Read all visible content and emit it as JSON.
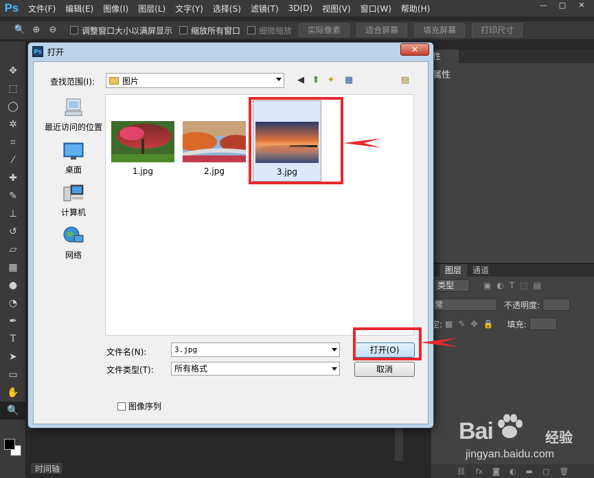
{
  "app": {
    "logo": "Ps",
    "menu": [
      "文件(F)",
      "编辑(E)",
      "图像(I)",
      "图层(L)",
      "文字(Y)",
      "选择(S)",
      "滤镜(T)",
      "3D(D)",
      "视图(V)",
      "窗口(W)",
      "帮助(H)"
    ],
    "window_controls": [
      "—",
      "□",
      "✕"
    ]
  },
  "options_bar": {
    "tool_icon": "zoom-icon",
    "check_resize": "调整窗口大小以满屏显示",
    "check_zoom_all": "缩放所有窗口",
    "check_scrubby": "细微缩放",
    "btn_actual": "实际像素",
    "btn_fit": "适合屏幕",
    "btn_fill": "填充屏幕",
    "btn_print": "打印尺寸"
  },
  "tools": [
    "move-icon",
    "marquee-icon",
    "lasso-icon",
    "magic-wand-icon",
    "crop-icon",
    "eyedropper-icon",
    "healing-icon",
    "brush-icon",
    "stamp-icon",
    "history-brush-icon",
    "eraser-icon",
    "gradient-icon",
    "blur-icon",
    "dodge-icon",
    "pen-icon",
    "type-icon",
    "path-select-icon",
    "shape-icon",
    "hand-icon",
    "zoom-icon"
  ],
  "colors": {
    "foreground": "#000000",
    "background": "#ffffff",
    "annotation": "#e8292e"
  },
  "right_panel": {
    "properties_tab": "性",
    "properties_title": "属性",
    "layers_tab": "图层",
    "channels_tab": "通道",
    "filter_kind": "类型",
    "blend_mode": "常",
    "opacity_label": "不透明度:",
    "lock_label": "定:",
    "fill_label": "填充:"
  },
  "timeline_tab": "时间轴",
  "dialog": {
    "title": "打开",
    "close": "✕",
    "look_in_label": "查找范围(I):",
    "look_in_value": "图片",
    "places": [
      {
        "label": "最近访问的位置",
        "icon": "recent-places-icon"
      },
      {
        "label": "桌面",
        "icon": "desktop-icon"
      },
      {
        "label": "计算机",
        "icon": "computer-icon"
      },
      {
        "label": "网络",
        "icon": "network-icon"
      }
    ],
    "files": [
      {
        "name": "1.jpg",
        "selected": false
      },
      {
        "name": "2.jpg",
        "selected": false
      },
      {
        "name": "3.jpg",
        "selected": true
      }
    ],
    "file_name_label": "文件名(N):",
    "file_name_value": "3.jpg",
    "file_type_label": "文件类型(T):",
    "file_type_value": "所有格式",
    "open_button": "打开(O)",
    "cancel_button": "取消",
    "image_sequence": "图像序列"
  },
  "watermark": {
    "brand": "Bai",
    "brand_cn": "经验",
    "url": "jingyan.baidu.com"
  }
}
